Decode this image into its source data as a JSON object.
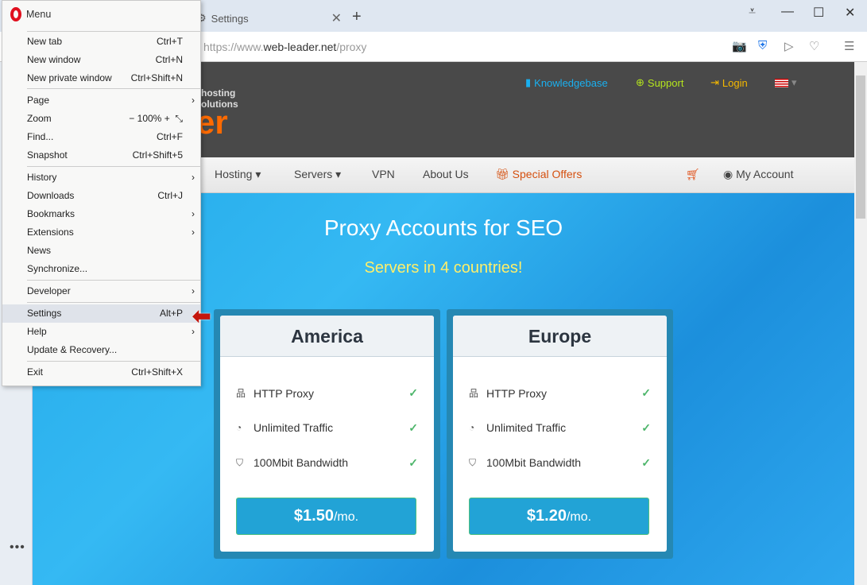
{
  "browser": {
    "tab_title": "Settings",
    "url_prefix": "https://www.",
    "url_domain": "web-leader.net",
    "url_path": "/proxy"
  },
  "menu": {
    "title": "Menu",
    "items": [
      {
        "label": "New tab",
        "shortcut": "Ctrl+T"
      },
      {
        "label": "New window",
        "shortcut": "Ctrl+N"
      },
      {
        "label": "New private window",
        "shortcut": "Ctrl+Shift+N"
      },
      {
        "label": "Page",
        "submenu": true
      },
      {
        "label": "Zoom",
        "zoom": "100%",
        "minus": "−",
        "plus": "+"
      },
      {
        "label": "Find...",
        "shortcut": "Ctrl+F"
      },
      {
        "label": "Snapshot",
        "shortcut": "Ctrl+Shift+5"
      },
      {
        "label": "History",
        "submenu": true
      },
      {
        "label": "Downloads",
        "shortcut": "Ctrl+J"
      },
      {
        "label": "Bookmarks",
        "submenu": true
      },
      {
        "label": "Extensions",
        "submenu": true
      },
      {
        "label": "News"
      },
      {
        "label": "Synchronize..."
      },
      {
        "label": "Developer",
        "submenu": true
      },
      {
        "label": "Settings",
        "shortcut": "Alt+P",
        "highlighted": true
      },
      {
        "label": "Help",
        "submenu": true
      },
      {
        "label": "Update & Recovery..."
      },
      {
        "label": "Exit",
        "shortcut": "Ctrl+Shift+X"
      }
    ]
  },
  "site": {
    "logo_tagline1": "hosting",
    "logo_tagline2": "olutions",
    "logo_text": "er",
    "top_links": [
      {
        "label": "Knowledgebase",
        "color": "#1ab0f0"
      },
      {
        "label": "Support",
        "color": "#b5e61d"
      },
      {
        "label": "Login",
        "color": "#f5b800"
      }
    ],
    "nav": [
      "Hosting",
      "Servers",
      "VPN",
      "About Us",
      "Special Offers",
      "My Account"
    ],
    "heading": "Proxy Accounts for SEO",
    "subheading": "Servers in 4 countries!",
    "plans": [
      {
        "name": "America",
        "features": [
          "HTTP Proxy",
          "Unlimited Traffic",
          "100Mbit Bandwidth"
        ],
        "price": "$1.50",
        "period": "/mo."
      },
      {
        "name": "Europe",
        "features": [
          "HTTP Proxy",
          "Unlimited Traffic",
          "100Mbit Bandwidth"
        ],
        "price": "$1.20",
        "period": "/mo."
      }
    ]
  }
}
